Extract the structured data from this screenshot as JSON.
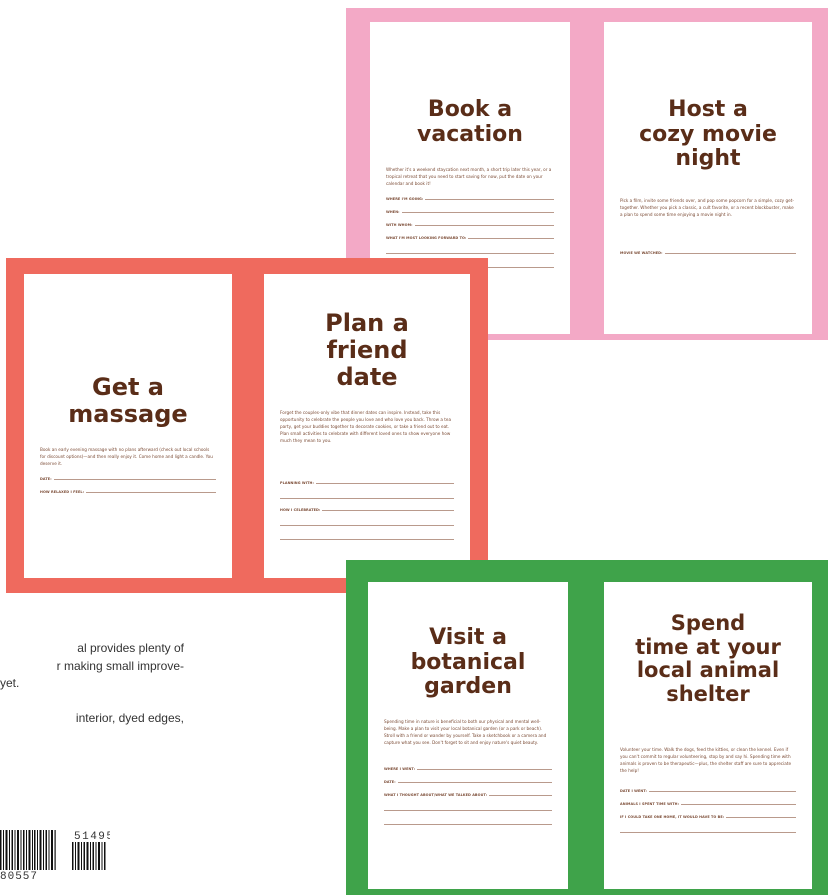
{
  "spreads": {
    "pink": {
      "color": "#f3a9c6",
      "left": {
        "title": [
          "Book a",
          "vacation"
        ],
        "body": "Whether it's a weekend staycation next month, a short trip later this year, or a tropical retreat that you need to start saving for now, put the date on your calendar and book it!",
        "fields": [
          "WHERE I'M GOING:",
          "WHEN:",
          "WITH WHOM:",
          "WHAT I'M MOST LOOKING FORWARD TO:"
        ]
      },
      "right": {
        "title": [
          "Host a",
          "cozy movie",
          "night"
        ],
        "body": "Pick a film, invite some friends over, and pop some popcorn for a simple, cozy get-together. Whether you pick a classic, a cult favorite, or a recent blockbuster, make a plan to spend some time enjoying a movie night in.",
        "fields": [
          "MOVIE WE WATCHED:"
        ]
      }
    },
    "red": {
      "color": "#ef6a5e",
      "left": {
        "title": [
          "Get a",
          "massage"
        ],
        "body": "Book an early evening massage with no plans afterward (check out local schools for discount options)—and then really enjoy it. Come home and light a candle. You deserve it.",
        "fields": [
          "DATE:",
          "HOW RELAXED I FEEL:"
        ]
      },
      "right": {
        "title": [
          "Plan a",
          "friend",
          "date"
        ],
        "body": "Forget the couples-only vibe that dinner dates can inspire. Instead, take this opportunity to celebrate the people you love and who love you back. Throw a tea party, get your buddies together to decorate cookies, or take a friend out to eat. Plan small activities to celebrate with different loved ones to show everyone how much they mean to you.",
        "fields": [
          "PLANNING WITH:",
          "HOW I CELEBRATED:"
        ]
      }
    },
    "green": {
      "color": "#3fa34a",
      "left": {
        "title": [
          "Visit a",
          "botanical",
          "garden"
        ],
        "body": "Spending time in nature is beneficial to both our physical and mental well-being. Make a plan to visit your local botanical garden (or a park or beach). Stroll with a friend or wander by yourself. Take a sketchbook or a camera and capture what you see. Don't forget to sit and enjoy nature's quiet beauty.",
        "fields": [
          "WHERE I WENT:",
          "DATE:",
          "WHAT I THOUGHT ABOUT/WHAT WE TALKED ABOUT:"
        ]
      },
      "right": {
        "title": [
          "Spend",
          "time at your",
          "local animal",
          "shelter"
        ],
        "body": "Volunteer your time. Walk the dogs, feed the kitties, or clean the kennel. Even if you can't commit to regular volunteering, stop by and say hi. Spending time with animals is proven to be therapeutic—plus, the shelter staff are sure to appreciate the help!",
        "fields": [
          "DATE I WENT:",
          "ANIMALS I SPENT TIME WITH:",
          "IF I COULD TAKE ONE HOME, IT WOULD HAVE TO BE:"
        ]
      }
    }
  },
  "description": {
    "para1": [
      "al provides plenty of",
      "r making small improve-",
      "yet."
    ],
    "para2": [
      "interior, dyed edges,"
    ]
  },
  "barcode": {
    "price_digits": "51495",
    "isbn_fragment": "80557"
  }
}
